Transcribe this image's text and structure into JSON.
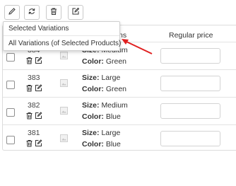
{
  "toolbar": {
    "buttons": [
      {
        "icon": "pencil-icon"
      },
      {
        "icon": "refresh-icon"
      },
      {
        "icon": "trash-icon"
      },
      {
        "icon": "edit-square-icon"
      }
    ]
  },
  "table": {
    "headers": {
      "attributes_fragment": "ns",
      "regular_price": "Regular price"
    },
    "rows": [
      {
        "id": "384",
        "size_label": "Size:",
        "size_value": "Medium",
        "color_label": "Color:",
        "color_value": "Green"
      },
      {
        "id": "383",
        "size_label": "Size:",
        "size_value": "Large",
        "color_label": "Color:",
        "color_value": "Green"
      },
      {
        "id": "382",
        "size_label": "Size:",
        "size_value": "Medium",
        "color_label": "Color:",
        "color_value": "Blue"
      },
      {
        "id": "381",
        "size_label": "Size:",
        "size_value": "Large",
        "color_label": "Color:",
        "color_value": "Blue"
      }
    ]
  },
  "dropdown": {
    "items": [
      {
        "label": "Selected Variations"
      },
      {
        "label": "All Variations (of Selected Products)"
      }
    ]
  },
  "colors": {
    "arrow": "#e02020"
  }
}
